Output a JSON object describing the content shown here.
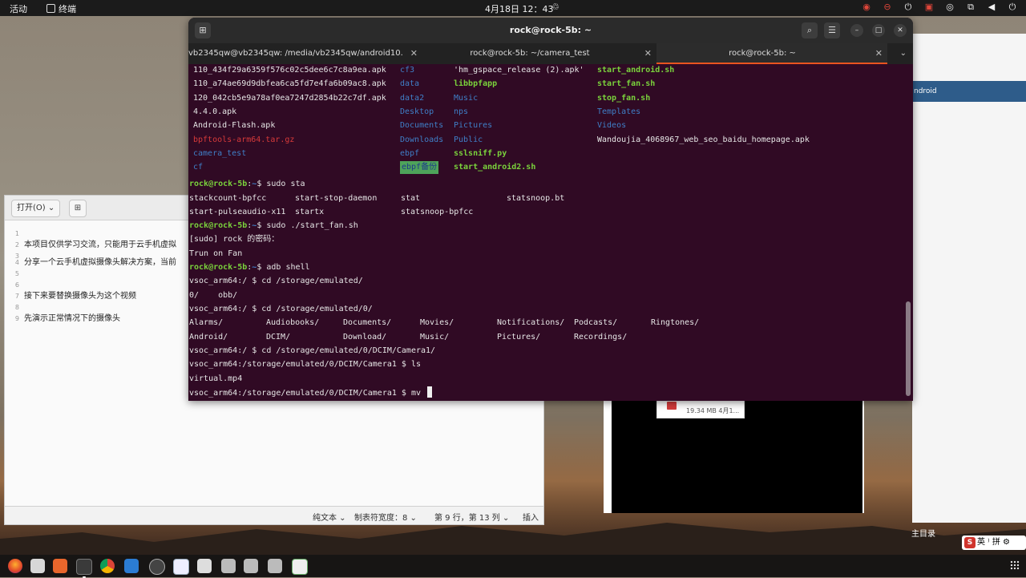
{
  "topbar": {
    "activities": "活动",
    "app_name": "终端",
    "clock": "4月18日  12：43",
    "clock_icon": "♲",
    "tray_icons": [
      "record-icon",
      "minus-circle-icon",
      "power-icon",
      "app-tray-icon",
      "wechat-icon",
      "network-icon",
      "volume-icon",
      "power-menu-icon"
    ]
  },
  "editor": {
    "open_label": "打开(O)  ⌄",
    "new_label": "⊞",
    "lines": [
      {
        "num": "1",
        "text": ""
      },
      {
        "num": "2",
        "text": "本项目仅供学习交流，只能用于云手机虚拟"
      },
      {
        "num": "3",
        "text": ""
      },
      {
        "num": "4",
        "text": "分享一个云手机虚拟摄像头解决方案，当前"
      },
      {
        "num": "5",
        "text": ""
      },
      {
        "num": "6",
        "text": ""
      },
      {
        "num": "7",
        "text": "接下来要替换摄像头为这个视频"
      },
      {
        "num": "8",
        "text": ""
      },
      {
        "num": "9",
        "text": "先演示正常情况下的摄像头"
      }
    ],
    "status": {
      "format": "纯文本 ⌄",
      "tab_width": "制表符宽度：8 ⌄",
      "position": "第 9 行，第 13 列  ⌄",
      "mode": "插入"
    }
  },
  "right_window": {
    "bar_label": "ndroid"
  },
  "phone": {
    "file_text": "19.34 MB  4月1..."
  },
  "home_label": "主目录",
  "ime": {
    "logo": "S",
    "label": "英 ⁾ 拼 ⚙"
  },
  "terminal": {
    "title": "rock@rock-5b: ~",
    "tabs": [
      {
        "label": "vb2345qw@vb2345qw: /media/vb2345qw/android10...",
        "close": "✕"
      },
      {
        "label": "rock@rock-5b: ~/camera_test",
        "close": "✕"
      },
      {
        "label": "rock@rock-5b: ~",
        "close": "✕"
      }
    ],
    "tab_menu": "⌄",
    "ls_columns": {
      "col1": [
        {
          "text": "110_434f29a6359f576c02c5dee6c7c8a9ea.apk",
          "color": "white"
        },
        {
          "text": "110_a74ae69d9dbfea6ca5fd7e4fa6b09ac8.apk",
          "color": "white"
        },
        {
          "text": "120_042cb5e9a78af0ea7247d2854b22c7df.apk",
          "color": "white"
        },
        {
          "text": "4.4.0.apk",
          "color": "white"
        },
        {
          "text": "Android-Flash.apk",
          "color": "white"
        },
        {
          "text": "bpftools-arm64.tar.gz",
          "color": "red"
        },
        {
          "text": "camera_test",
          "color": "blue"
        },
        {
          "text": "cf",
          "color": "blue"
        }
      ],
      "col2": [
        {
          "text": "cf3",
          "color": "blue"
        },
        {
          "text": "data",
          "color": "blue"
        },
        {
          "text": "data2",
          "color": "blue"
        },
        {
          "text": "Desktop",
          "color": "blue"
        },
        {
          "text": "Documents",
          "color": "blue"
        },
        {
          "text": "Downloads",
          "color": "blue"
        },
        {
          "text": "ebpf",
          "color": "blue"
        },
        {
          "text": "ebpf备份",
          "color": "highlight"
        }
      ],
      "col3": [
        {
          "text": "'hm_gspace_release (2).apk'",
          "color": "white"
        },
        {
          "text": "libbpfapp",
          "color": "green"
        },
        {
          "text": "Music",
          "color": "blue"
        },
        {
          "text": "nps",
          "color": "blue"
        },
        {
          "text": "Pictures",
          "color": "blue"
        },
        {
          "text": "Public",
          "color": "blue"
        },
        {
          "text": "sslsniff.py",
          "color": "green"
        },
        {
          "text": "start_android2.sh",
          "color": "green"
        }
      ],
      "col4": [
        {
          "text": "start_android.sh",
          "color": "green"
        },
        {
          "text": "start_fan.sh",
          "color": "green"
        },
        {
          "text": "stop_fan.sh",
          "color": "green"
        },
        {
          "text": "Templates",
          "color": "blue"
        },
        {
          "text": "Videos",
          "color": "blue"
        },
        {
          "text": "Wandoujia_4068967_web_seo_baidu_homepage.apk",
          "color": "white"
        },
        {
          "text": "",
          "color": "white"
        },
        {
          "text": "",
          "color": "white"
        }
      ]
    },
    "prompt_user": "rock@rock-5b",
    "prompt_sep": ":",
    "prompt_path": "~",
    "prompt_dollar": "$ ",
    "cmd1": "sudo sta",
    "completions1": [
      "stackcount-bpfcc",
      "start-stop-daemon",
      "stat",
      "statsnoop.bt"
    ],
    "completions2": [
      "start-pulseaudio-x11",
      "startx",
      "statsnoop-bpfcc"
    ],
    "cmd2": "sudo ./start_fan.sh",
    "sudo_prompt": "[sudo] rock 的密码：",
    "fan_msg": "Trun on Fan",
    "cmd3": "adb shell",
    "adb_lines": [
      "vsoc_arm64:/ $ cd /storage/emulated/",
      "0/    obb/",
      "vsoc_arm64:/ $ cd /storage/emulated/0/"
    ],
    "dirs_row1": [
      "Alarms/",
      "Audiobooks/",
      "Documents/",
      "Movies/",
      "Notifications/",
      "Podcasts/",
      "Ringtones/"
    ],
    "dirs_row2": [
      "Android/",
      "DCIM/",
      "Download/",
      "Music/",
      "Pictures/",
      "Recordings/"
    ],
    "adb_lines2": [
      "vsoc_arm64:/ $ cd /storage/emulated/0/DCIM/Camera1/",
      "vsoc_arm64:/storage/emulated/0/DCIM/Camera1 $ ls",
      "virtual.mp4",
      "vsoc_arm64:/storage/emulated/0/DCIM/Camera1 $ mv "
    ]
  },
  "dock_icons": [
    "firefox-icon",
    "files-icon",
    "software-center-icon",
    "terminal-icon",
    "chrome-icon",
    "vscode-icon",
    "text-editor-icon",
    "app-icon",
    "disk-icon",
    "disk-icon-2",
    "trash-icon",
    "show-apps-icon"
  ]
}
